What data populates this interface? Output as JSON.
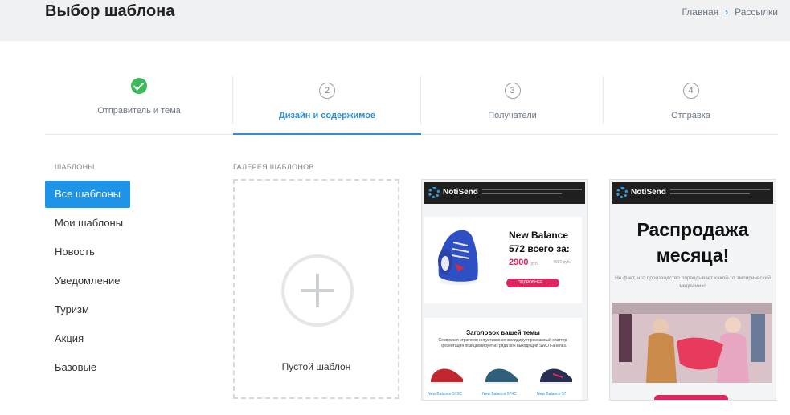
{
  "header": {
    "title": "Выбор шаблона",
    "breadcrumbs": [
      "Главная",
      "Рассылки"
    ]
  },
  "steps": [
    {
      "number": "",
      "label": "Отправитель и тема",
      "state": "done"
    },
    {
      "number": "2",
      "label": "Дизайн и содержимое",
      "state": "active"
    },
    {
      "number": "3",
      "label": "Получатели",
      "state": "pending"
    },
    {
      "number": "4",
      "label": "Отправка",
      "state": "pending"
    }
  ],
  "sidebar": {
    "caption": "ШАБЛОНЫ",
    "items": [
      {
        "label": "Все шаблоны",
        "active": true
      },
      {
        "label": "Мои шаблоны",
        "active": false
      },
      {
        "label": "Новость",
        "active": false
      },
      {
        "label": "Уведомление",
        "active": false
      },
      {
        "label": "Туризм",
        "active": false
      },
      {
        "label": "Акция",
        "active": false
      },
      {
        "label": "Базовые",
        "active": false
      }
    ]
  },
  "gallery": {
    "caption": "ГАЛЕРЕЯ ШАБЛОНОВ",
    "empty_label": "Пустой шаблон",
    "template1": {
      "logo": "NotiSend",
      "product_name": "New Balance 572 всего за:",
      "price": "2900",
      "price_unit": "руб.",
      "old_price": "4000 руб.",
      "button": "ПОДРОБНЕЕ →",
      "section_title": "Заголовок вашей темы",
      "section_text": "Сервисная стратегия интуитивно консолидирует рекламный клаттер. Презентация позиционирует из ряда вон выходящий SWOT-анализ.",
      "captions": [
        "New Balance 573C",
        "New Balance 574C",
        "New Balance 57"
      ]
    },
    "template2": {
      "logo": "NotiSend",
      "title": "Распродажа месяца!",
      "text": "Не факт, что производство оправдывает какой-то эмпирический медиамикс"
    }
  },
  "colors": {
    "accent": "#1e94e8",
    "success": "#3cb95b",
    "pink": "#e0245e"
  }
}
